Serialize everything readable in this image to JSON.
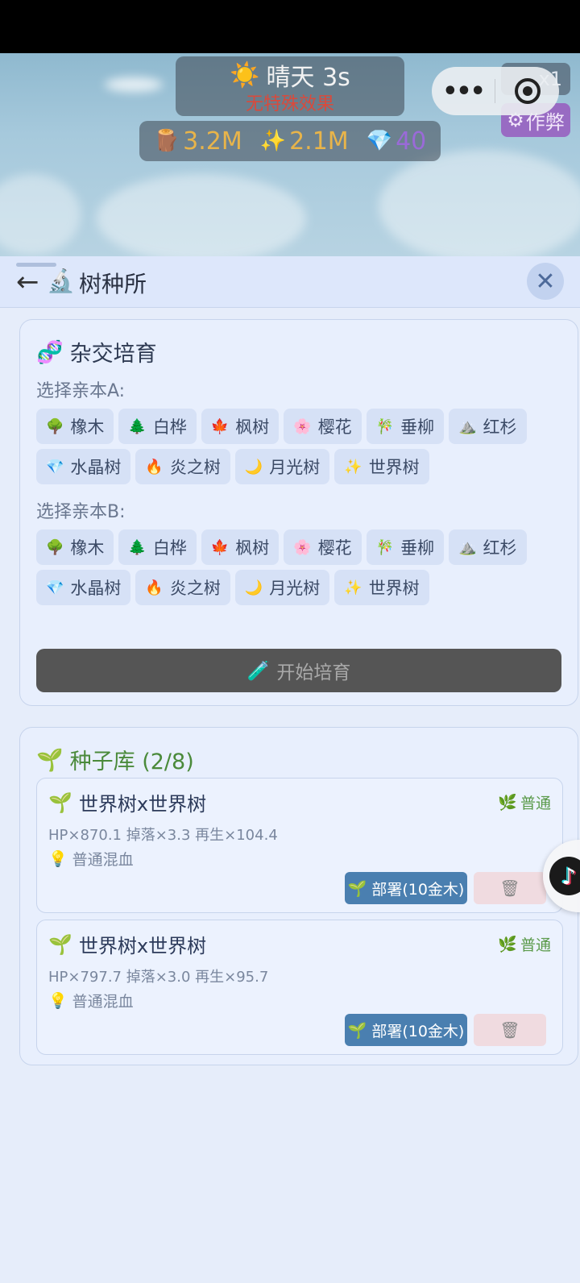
{
  "game": {
    "weather": {
      "icon": "☀️",
      "label": "晴天 3s",
      "effect": "无特殊效果"
    },
    "resources": [
      {
        "icon": "🪵",
        "value": "3.2M"
      },
      {
        "icon": "✨",
        "value": "2.1M"
      },
      {
        "icon": "💎",
        "value": "40"
      }
    ],
    "speed_label": "x1",
    "cheat_label": "作弊"
  },
  "panel": {
    "back": "←",
    "title_icon": "🔬",
    "title": "树种所",
    "close": "✕"
  },
  "breed": {
    "icon": "🧬",
    "title": "杂交培育",
    "parent_a_label": "选择亲本A:",
    "parent_b_label": "选择亲本B:",
    "trees": [
      {
        "icon": "🌳",
        "label": "橡木"
      },
      {
        "icon": "🌲",
        "label": "白桦"
      },
      {
        "icon": "🍁",
        "label": "枫树"
      },
      {
        "icon": "🌸",
        "label": "樱花"
      },
      {
        "icon": "🎋",
        "label": "垂柳"
      },
      {
        "icon": "⛰️",
        "label": "红杉"
      },
      {
        "icon": "💎",
        "label": "水晶树"
      },
      {
        "icon": "🔥",
        "label": "炎之树"
      },
      {
        "icon": "🌙",
        "label": "月光树"
      },
      {
        "icon": "✨",
        "label": "世界树"
      }
    ],
    "start_icon": "🧪",
    "start_label": "开始培育"
  },
  "seeds": {
    "icon": "🌱",
    "title": "种子库 (2/8)",
    "items": [
      {
        "name": "世界树x世界树",
        "tag": "普通",
        "stats": "HP×870.1 掉落×3.3 再生×104.4",
        "note": "普通混血",
        "deploy": "部署(10金木)"
      },
      {
        "name": "世界树x世界树",
        "tag": "普通",
        "stats": "HP×797.7 掉落×3.0 再生×95.7",
        "note": "普通混血",
        "deploy": "部署(10金木)"
      }
    ]
  },
  "colors": {
    "panel_bg": "#e6edfa",
    "card_bg": "#e8effd",
    "deploy_button": "#4a7fb0",
    "delete_button": "#f0dbe0",
    "start_button_disabled": "#555555"
  }
}
